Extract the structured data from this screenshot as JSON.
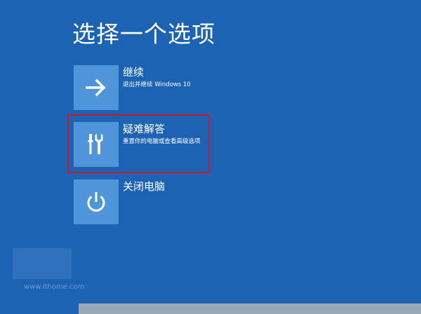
{
  "header": {
    "title": "选择一个选项"
  },
  "options": [
    {
      "title": "继续",
      "description": "退出并继续 Windows 10",
      "icon": "arrow-right-icon"
    },
    {
      "title": "疑难解答",
      "description": "重置你的电脑或查看高级选项",
      "icon": "tools-icon"
    },
    {
      "title": "关闭电脑",
      "description": "",
      "icon": "power-icon"
    }
  ],
  "highlighted_option": "疑难解答",
  "watermark": {
    "text": "www.ithome.com"
  },
  "colors": {
    "background": "#1d63b3",
    "tile": "#4e95d9",
    "highlight_border": "#d0182b",
    "text": "#ffffff"
  }
}
